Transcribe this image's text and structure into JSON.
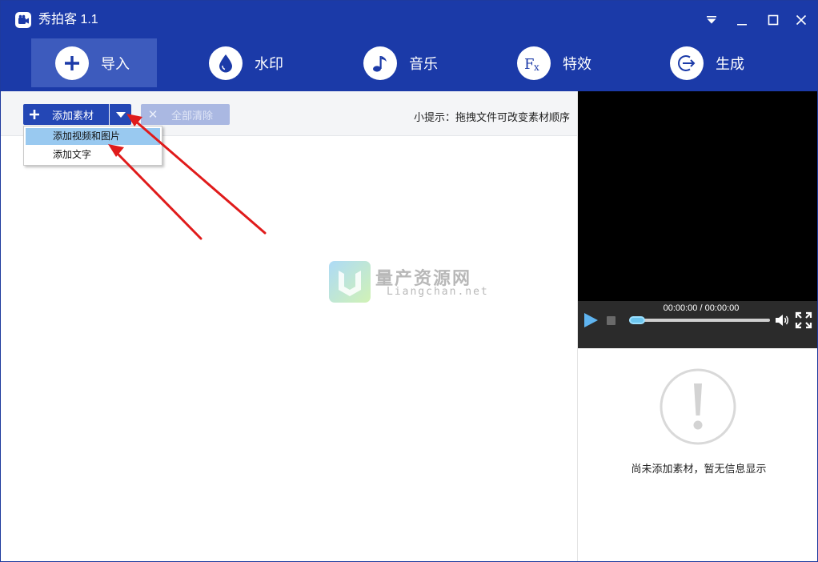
{
  "titlebar": {
    "title": "秀拍客 1.1"
  },
  "nav": {
    "items": [
      {
        "label": "导入",
        "icon": "plus-icon",
        "active": true
      },
      {
        "label": "水印",
        "icon": "droplet-icon",
        "active": false
      },
      {
        "label": "音乐",
        "icon": "music-note-icon",
        "active": false
      },
      {
        "label": "特效",
        "icon": "fx-icon",
        "active": false
      },
      {
        "label": "生成",
        "icon": "export-arrow-icon",
        "active": false
      }
    ]
  },
  "toolbar": {
    "add_label": "添加素材",
    "clear_label": "全部清除",
    "tip": "小提示：拖拽文件可改变素材顺序"
  },
  "dropdown": {
    "items": [
      {
        "label": "添加视频和图片",
        "highlighted": true
      },
      {
        "label": "添加文字",
        "highlighted": false
      }
    ]
  },
  "player": {
    "time": "00:00:00 / 00:00:00"
  },
  "info": {
    "empty_message": "尚未添加素材，暂无信息显示"
  },
  "watermark": {
    "title": "量产资源网",
    "subtitle": "Liangchan.net"
  },
  "colors": {
    "brand_blue": "#1b3aa8",
    "button_blue": "#2447b5",
    "annotation_red": "#e01b1b"
  }
}
